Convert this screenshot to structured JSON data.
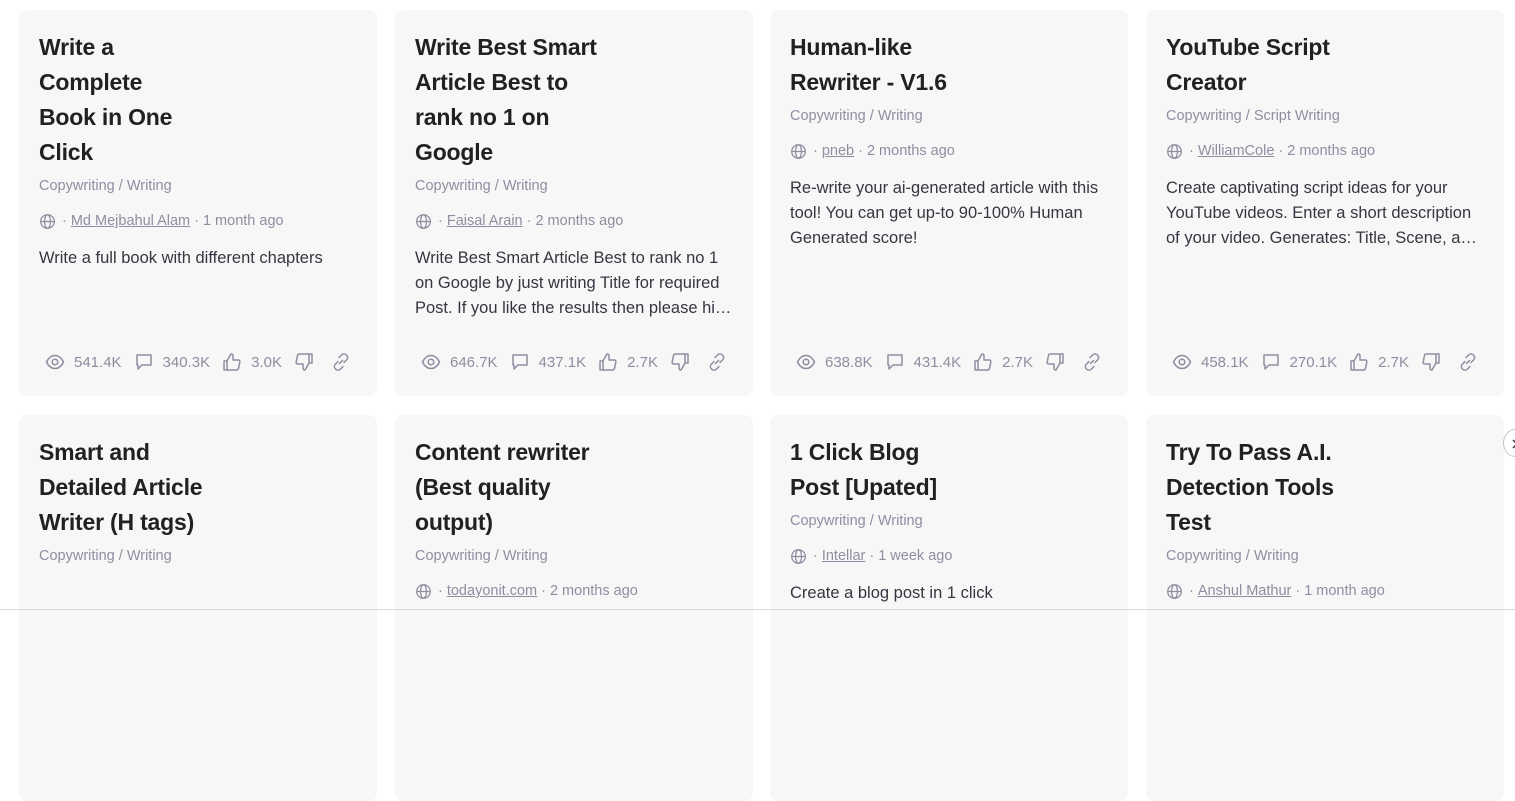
{
  "cards": [
    {
      "title": "Write a Complete Book in One Click",
      "category": "Copywriting / Writing",
      "author": "Md Mejbahul Alam",
      "time": "1 month ago",
      "description": "Write a full book with different chapters",
      "views": "541.4K",
      "comments": "340.3K",
      "likes": "3.0K"
    },
    {
      "title": "Write Best Smart Article Best to rank no 1 on Google",
      "category": "Copywriting / Writing",
      "author": "Faisal Arain",
      "time": "2 months ago",
      "description": "Write Best Smart Article Best to rank no 1 on Google by just writing Title for required Post. If you like the results then please hit like button. Subscribe my YouTube Channel.",
      "views": "646.7K",
      "comments": "437.1K",
      "likes": "2.7K"
    },
    {
      "title": "Human-like Rewriter - V1.6",
      "category": "Copywriting / Writing",
      "author": "pneb",
      "time": "2 months ago",
      "description": "Re-write your ai-generated article with this tool! You can get up-to 90-100% Human Generated score!",
      "views": "638.8K",
      "comments": "431.4K",
      "likes": "2.7K"
    },
    {
      "title": "YouTube Script Creator",
      "category": "Copywriting / Script Writing",
      "author": "WilliamCole",
      "time": "2 months ago",
      "description": "Create captivating script ideas for your YouTube videos. Enter a short description of your video. Generates: Title, Scene, and Full Script.",
      "views": "458.1K",
      "comments": "270.1K",
      "likes": "2.7K"
    },
    {
      "title": "Smart and Detailed Article Writer (H tags)",
      "category": "Copywriting / Writing"
    },
    {
      "title": "Content rewriter (Best quality output)",
      "category": "Copywriting / Writing",
      "author": "todayonit.com",
      "time": "2 months ago"
    },
    {
      "title": "1 Click Blog Post [Upated]",
      "category": "Copywriting / Writing",
      "author": "Intellar",
      "time": "1 week ago",
      "description": "Create a blog post in 1 click"
    },
    {
      "title": "Try To Pass A.I. Detection Tools Test",
      "category": "Copywriting / Writing",
      "author": "Anshul Mathur",
      "time": "1 month ago"
    }
  ],
  "icons": {
    "globe": "globe-icon",
    "views": "eye-icon",
    "comments": "comment-icon",
    "like": "thumbs-up-icon",
    "dislike": "thumbs-down-icon",
    "link": "link-icon",
    "scroll": "chevron-right-icon"
  },
  "colors": {
    "card_bg": "#f7f7f8",
    "title": "#202123",
    "muted": "#8e8ea0",
    "body": "#353740"
  }
}
